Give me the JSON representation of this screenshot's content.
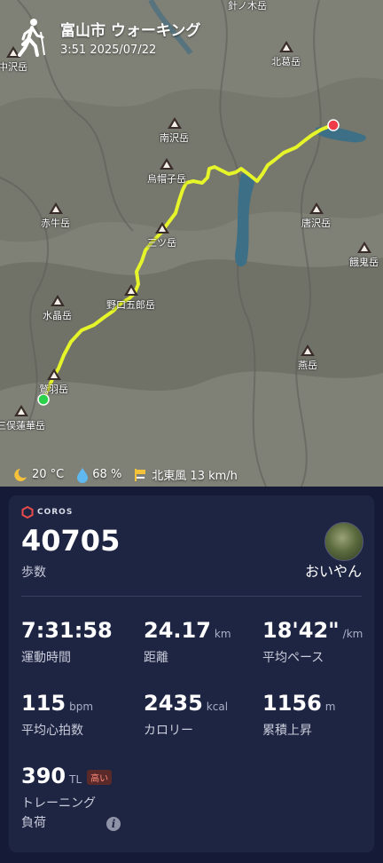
{
  "map": {
    "title": "富山市 ウォーキング",
    "subtitle": "3:51 2025/07/22",
    "peaks": [
      {
        "name": "針ノ木岳"
      },
      {
        "name": "中沢岳"
      },
      {
        "name": "北葛岳"
      },
      {
        "name": "南沢岳"
      },
      {
        "name": "烏帽子岳"
      },
      {
        "name": "赤牛岳"
      },
      {
        "name": "唐沢岳"
      },
      {
        "name": "餓鬼岳"
      },
      {
        "name": "三ツ岳"
      },
      {
        "name": "野口五郎岳"
      },
      {
        "name": "水晶岳"
      },
      {
        "name": "燕岳"
      },
      {
        "name": "鷲羽岳"
      },
      {
        "name": "三俣蓮華岳"
      }
    ],
    "weather": {
      "temperature": "20 °C",
      "humidity": "68 %",
      "wind": "北東風 13 km/h"
    }
  },
  "card": {
    "brand": "COROS",
    "steps_value": "40705",
    "steps_label": "歩数",
    "username": "おいやん",
    "metrics": [
      {
        "value": "7:31:58",
        "unit": "",
        "label": "運動時間"
      },
      {
        "value": "24.17",
        "unit": "km",
        "label": "距離"
      },
      {
        "value": "18'42\"",
        "unit": "/km",
        "label": "平均ペース"
      },
      {
        "value": "115",
        "unit": "bpm",
        "label": "平均心拍数"
      },
      {
        "value": "2435",
        "unit": "kcal",
        "label": "カロリー"
      },
      {
        "value": "1156",
        "unit": "m",
        "label": "累積上昇"
      },
      {
        "value": "390",
        "unit": "TL",
        "label": "トレーニング",
        "label2": "負荷",
        "badge": "高い"
      }
    ]
  },
  "colors": {
    "track": "#e6f52a",
    "start_point": "#2bd14a",
    "end_point": "#ef3b4a",
    "card_bg": "#1e2542",
    "page_bg": "#151a36",
    "water": "#3d6f86"
  },
  "icons": [
    "walker-icon",
    "peak-icon",
    "sun-moon-icon",
    "droplet-icon",
    "wind-icon",
    "coros-logo-icon",
    "info-icon"
  ]
}
